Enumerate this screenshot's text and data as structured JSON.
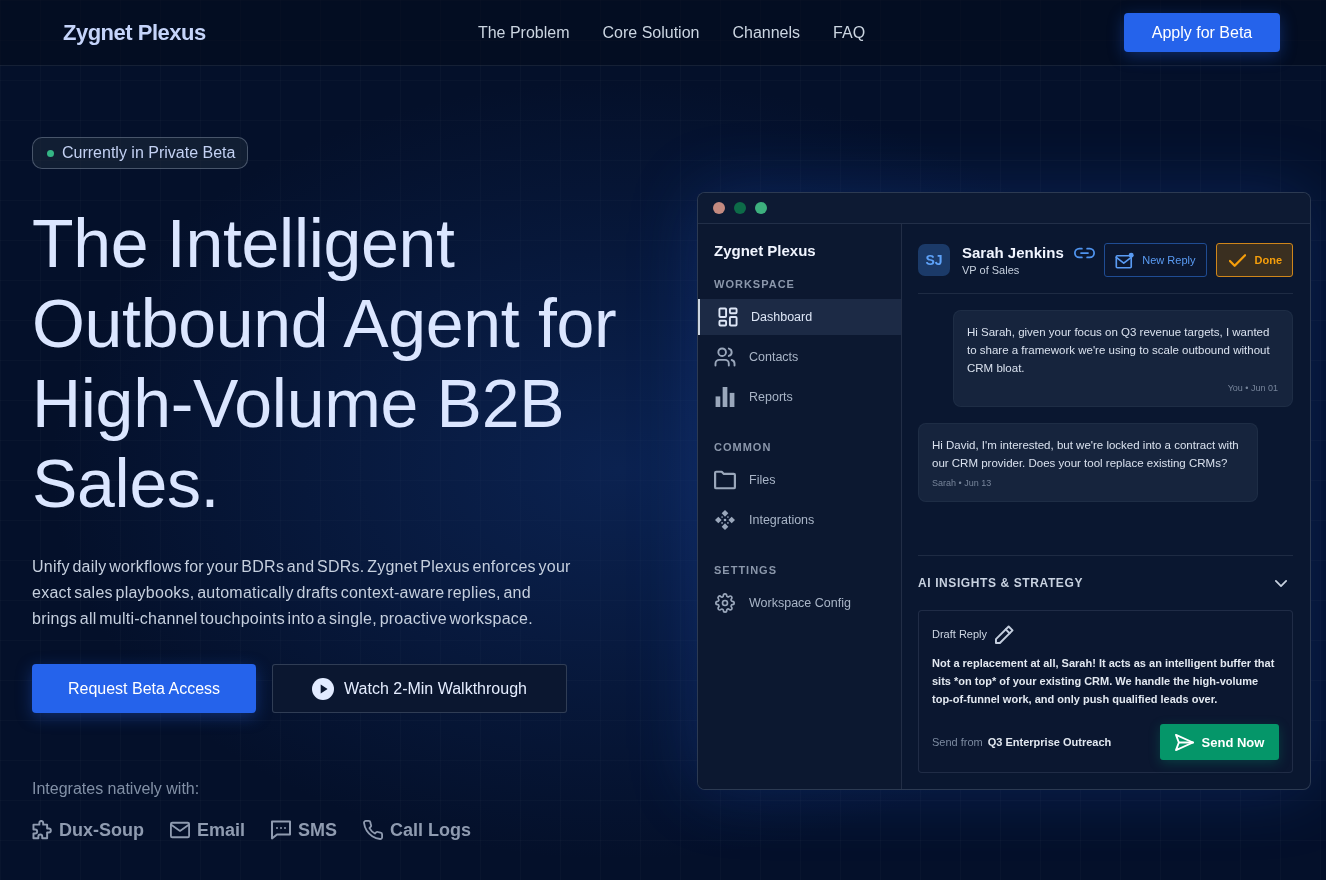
{
  "nav": {
    "logo": "Zygnet Plexus",
    "links": [
      "The Problem",
      "Core Solution",
      "Channels",
      "FAQ"
    ],
    "cta": "Apply for Beta"
  },
  "hero": {
    "badge": "Currently in Private Beta",
    "headline": "The Intelligent Outbound Agent for High-Volume B2B Sales.",
    "description": "Unify daily workflows for your BDRs and SDRs. Zygnet Plexus enforces your exact sales playbooks, automatically drafts context-aware replies, and brings all multi-channel touchpoints into a single, proactive workspace.",
    "buttons": [
      {
        "label": "Request Beta Access",
        "kind": "primary"
      },
      {
        "label": "Watch 2-Min Walkthrough",
        "kind": "video"
      }
    ],
    "integrations_label": "Integrates natively with:",
    "integrations": [
      {
        "label": "Dux-Soup",
        "kind": "plugin"
      },
      {
        "label": "Email",
        "kind": "email"
      },
      {
        "label": "SMS",
        "kind": "sms"
      },
      {
        "label": "Call Logs",
        "kind": "phone"
      }
    ]
  },
  "app": {
    "sidebar": {
      "title": "Zygnet Plexus",
      "sections": [
        {
          "heading": "WORKSPACE",
          "items": [
            {
              "label": "Dashboard",
              "kind": "dashboard",
              "selected": true
            },
            {
              "label": "Contacts",
              "kind": "contacts",
              "selected": false
            },
            {
              "label": "Reports",
              "kind": "reports",
              "selected": false
            }
          ]
        },
        {
          "heading": "COMMON",
          "items": [
            {
              "label": "Files",
              "kind": "files",
              "selected": false
            },
            {
              "label": "Integrations",
              "kind": "integrations",
              "selected": false
            }
          ]
        },
        {
          "heading": "SETTINGS",
          "items": [
            {
              "label": "Workspace Config",
              "kind": "settings",
              "selected": false
            }
          ]
        }
      ]
    },
    "contact": {
      "initials": "SJ",
      "name": "Sarah Jenkins",
      "role": "VP of Sales"
    },
    "actions": [
      {
        "label": "New Reply",
        "kind": "reply"
      },
      {
        "label": "Done",
        "kind": "done"
      }
    ],
    "messages": [
      {
        "kind": "outgoing",
        "text": "Hi Sarah, given your focus on Q3 revenue targets, I wanted to share a framework we're using to scale outbound without CRM bloat.",
        "meta": "You • Jun 01"
      },
      {
        "kind": "incoming",
        "text": "Hi David, I'm interested, but we're locked into a contract with our CRM provider. Does your tool replace existing CRMs?",
        "meta": "Sarah • Jun 13"
      }
    ],
    "insights": {
      "title": "AI INSIGHTS & STRATEGY",
      "expanded": true,
      "draft": {
        "label": "Draft Reply",
        "text": "Not a replacement at all, Sarah! It acts as an intelligent buffer that sits *on top* of your existing CRM. We handle the high-volume top-of-funnel work, and only push qualified leads over.",
        "send_from_label": "Send from",
        "send_from_value": "Q3 Enterprise Outreach",
        "send_button": "Send Now"
      }
    }
  }
}
